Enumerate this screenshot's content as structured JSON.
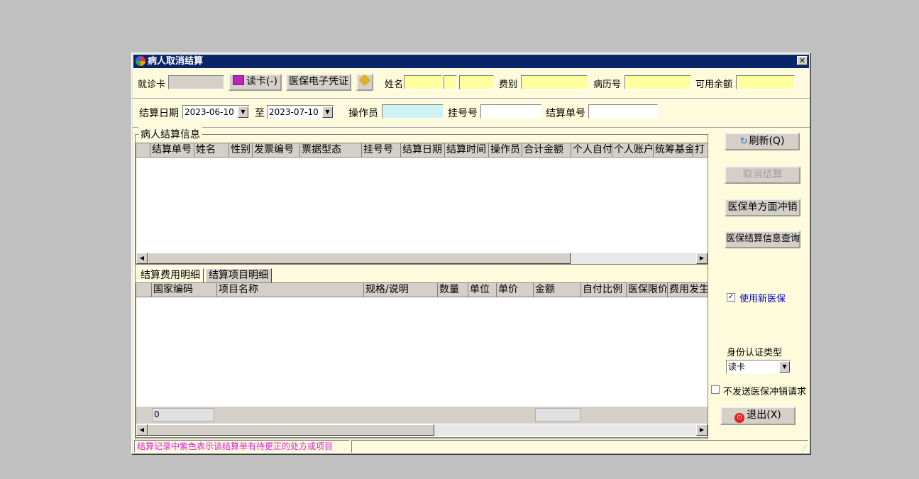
{
  "window": {
    "title": "病人取消结算",
    "close_glyph": "✕"
  },
  "row1": {
    "card_label": "就诊卡",
    "read_card_button": "读卡(-)",
    "ecert_button": "医保电子凭证",
    "clear_icon": "broom-icon",
    "name_label": "姓名",
    "fee_type_label": "费别",
    "record_no_label": "病历号",
    "balance_label": "可用余额"
  },
  "row2": {
    "settle_date_label": "结算日期",
    "date_from": "2023-06-10",
    "to_label": "至",
    "date_to": "2023-07-10",
    "operator_label": "操作员",
    "reg_no_label": "挂号号",
    "settle_no_label": "结算单号"
  },
  "group_title": "病人结算信息",
  "upper_columns": [
    "结算单号",
    "姓名",
    "性别",
    "发票编号",
    "票据型态",
    "挂号号",
    "结算日期",
    "结算时间",
    "操作员",
    "合计金额",
    "个人自付",
    "个人账户",
    "统筹基金",
    "打"
  ],
  "tabs": [
    "结算费用明细",
    "结算项目明细"
  ],
  "lower_columns": [
    "国家编码",
    "项目名称",
    "规格/说明",
    "数量",
    "单位",
    "单价",
    "金额",
    "自付比例",
    "医保限价",
    "费用发生"
  ],
  "lower_footer": {
    "count": "0"
  },
  "side": {
    "refresh_button": "刷新(Q)",
    "cancel_button": "取消结算",
    "reverse_button": "医保单方面冲销",
    "query_button": "医保结算信息查询",
    "use_new_label": "使用新医保",
    "use_new_checked": true,
    "id_type_label": "身份认证类型",
    "id_type_value": "读卡",
    "no_send_label": "不发送医保冲销请求",
    "no_send_checked": false,
    "exit_button": "退出(X)"
  },
  "status_text": "结算记录中紫色表示该结算单有待更正的处方或项目",
  "colors": {
    "title_bg": "#0a246a",
    "window_bg": "#fdfbdc",
    "field_yellow": "#ffff9e",
    "status_text": "#e020e0",
    "link_blue": "#0000c0"
  }
}
